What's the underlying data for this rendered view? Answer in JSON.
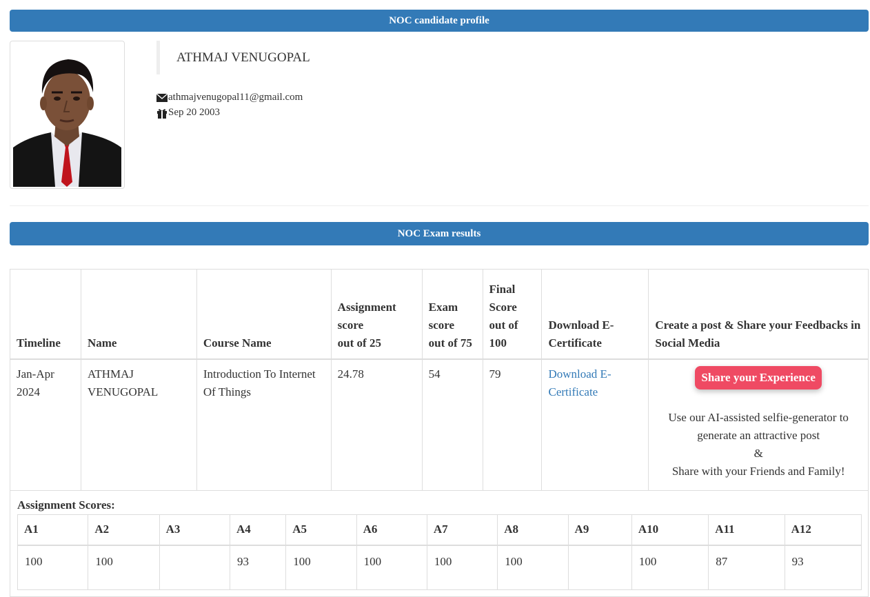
{
  "header": {
    "profile_title": "NOC candidate profile",
    "results_title": "NOC Exam results"
  },
  "profile": {
    "name": "ATHMAJ VENUGOPAL",
    "email": "athmajvenugopal11@gmail.com",
    "dob": "Sep 20 2003",
    "email_icon": "envelope-icon",
    "dob_icon": "gift-icon"
  },
  "results": {
    "headers": {
      "timeline": "Timeline",
      "name": "Name",
      "course": "Course Name",
      "assignment": [
        "Assignment",
        "score",
        "out of 25"
      ],
      "exam": [
        "Exam",
        "score",
        "out of 75"
      ],
      "final": [
        "Final",
        "Score",
        "out of",
        "100"
      ],
      "download": "Download E-Certificate",
      "share": "Create a post & Share your Feedbacks in Social Media"
    },
    "row": {
      "timeline": "Jan-Apr 2024",
      "name": "ATHMAJ VENUGOPAL",
      "course": "Introduction To Internet Of Things",
      "assignment": "24.78",
      "exam": "54",
      "final": "79",
      "download_link": "Download E-Certificate",
      "share_button": "Share your Experience",
      "share_lines": [
        "Use our AI-assisted selfie-generator to",
        "generate an attractive post",
        "&",
        "Share with your Friends and Family!"
      ]
    }
  },
  "assignments": {
    "title": "Assignment Scores:",
    "headers": [
      "A1",
      "A2",
      "A3",
      "A4",
      "A5",
      "A6",
      "A7",
      "A8",
      "A9",
      "A10",
      "A11",
      "A12"
    ],
    "scores": [
      "100",
      "100",
      "",
      "93",
      "100",
      "100",
      "100",
      "100",
      "",
      "100",
      "87",
      "93"
    ]
  },
  "colors": {
    "primary": "#337ab7",
    "share_button": "#ef4a63",
    "border": "#dddddd"
  }
}
